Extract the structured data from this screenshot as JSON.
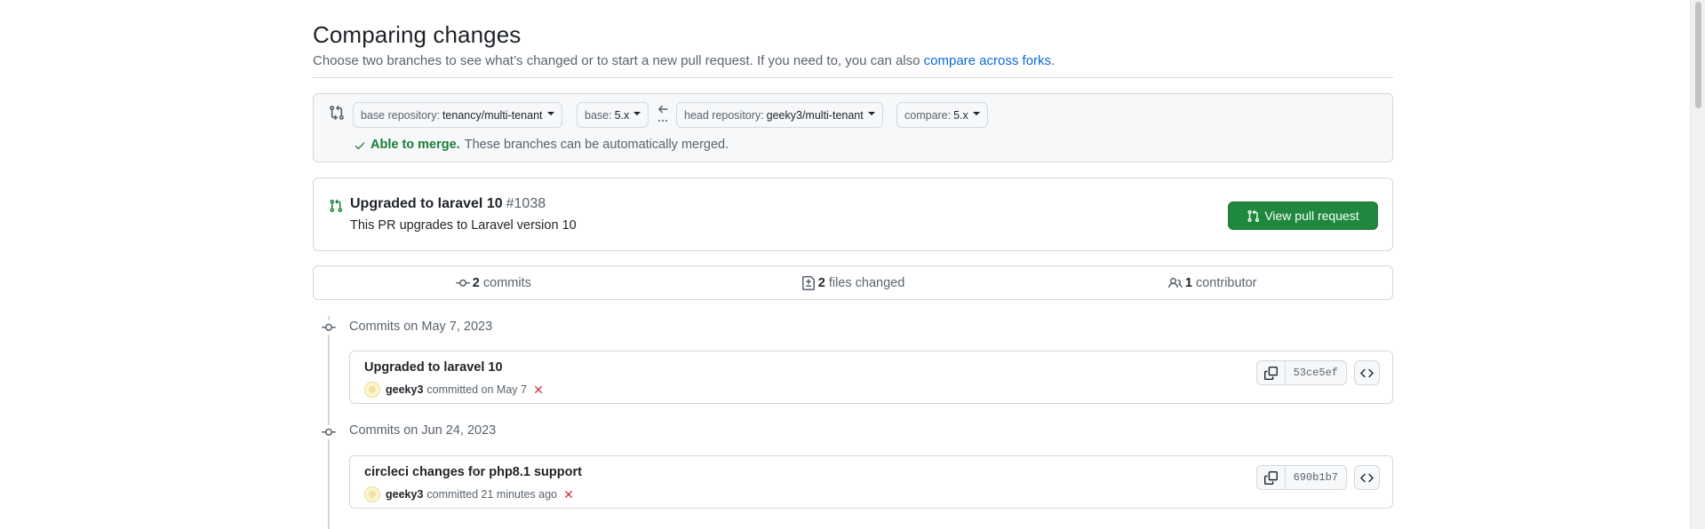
{
  "header": {
    "title": "Comparing changes",
    "subtitle": "Choose two branches to see what’s changed or to start a new pull request. If you need to, you can also",
    "compare_forks_link": "compare across forks",
    "subtitle_end": "."
  },
  "range": {
    "base_repo_label": "base repository:",
    "base_repo_value": "tenancy/multi-tenant",
    "base_label": "base:",
    "base_value": "5.x",
    "head_repo_label": "head repository:",
    "head_repo_value": "geeky3/multi-tenant",
    "compare_label": "compare:",
    "compare_value": "5.x",
    "merge_ok": "Able to merge.",
    "merge_text": "These branches can be automatically merged."
  },
  "pull_request": {
    "title": "Upgraded to laravel 10",
    "number": "#1038",
    "description": "This PR upgrades to Laravel version 10",
    "button_label": "View pull request"
  },
  "summary": {
    "commits_count": "2",
    "commits_label": "commits",
    "files_count": "2",
    "files_label": "files changed",
    "contributors_count": "1",
    "contributors_label": "contributor"
  },
  "commit_groups": [
    {
      "date": "Commits on May 7, 2023",
      "commit": {
        "title": "Upgraded to laravel 10",
        "author": "geeky3",
        "meta": "committed on May 7",
        "sha": "53ce5ef"
      }
    },
    {
      "date": "Commits on Jun 24, 2023",
      "commit": {
        "title": "circleci changes for php8.1 support",
        "author": "geeky3",
        "meta": "committed 21 minutes ago",
        "sha": "690b1b7"
      }
    }
  ],
  "colors": {
    "accent_link": "#0969da",
    "success": "#1a7f37",
    "button_green": "#1f883d",
    "error": "#d1242f",
    "muted": "#59636e",
    "border": "#d1d9e0"
  },
  "icons": [
    "compare-icon",
    "caret-down-icon",
    "arrow-left-icon",
    "check-icon",
    "git-pull-request-icon",
    "git-commit-icon",
    "file-diff-icon",
    "people-icon",
    "copy-icon",
    "x-icon",
    "code-icon"
  ]
}
